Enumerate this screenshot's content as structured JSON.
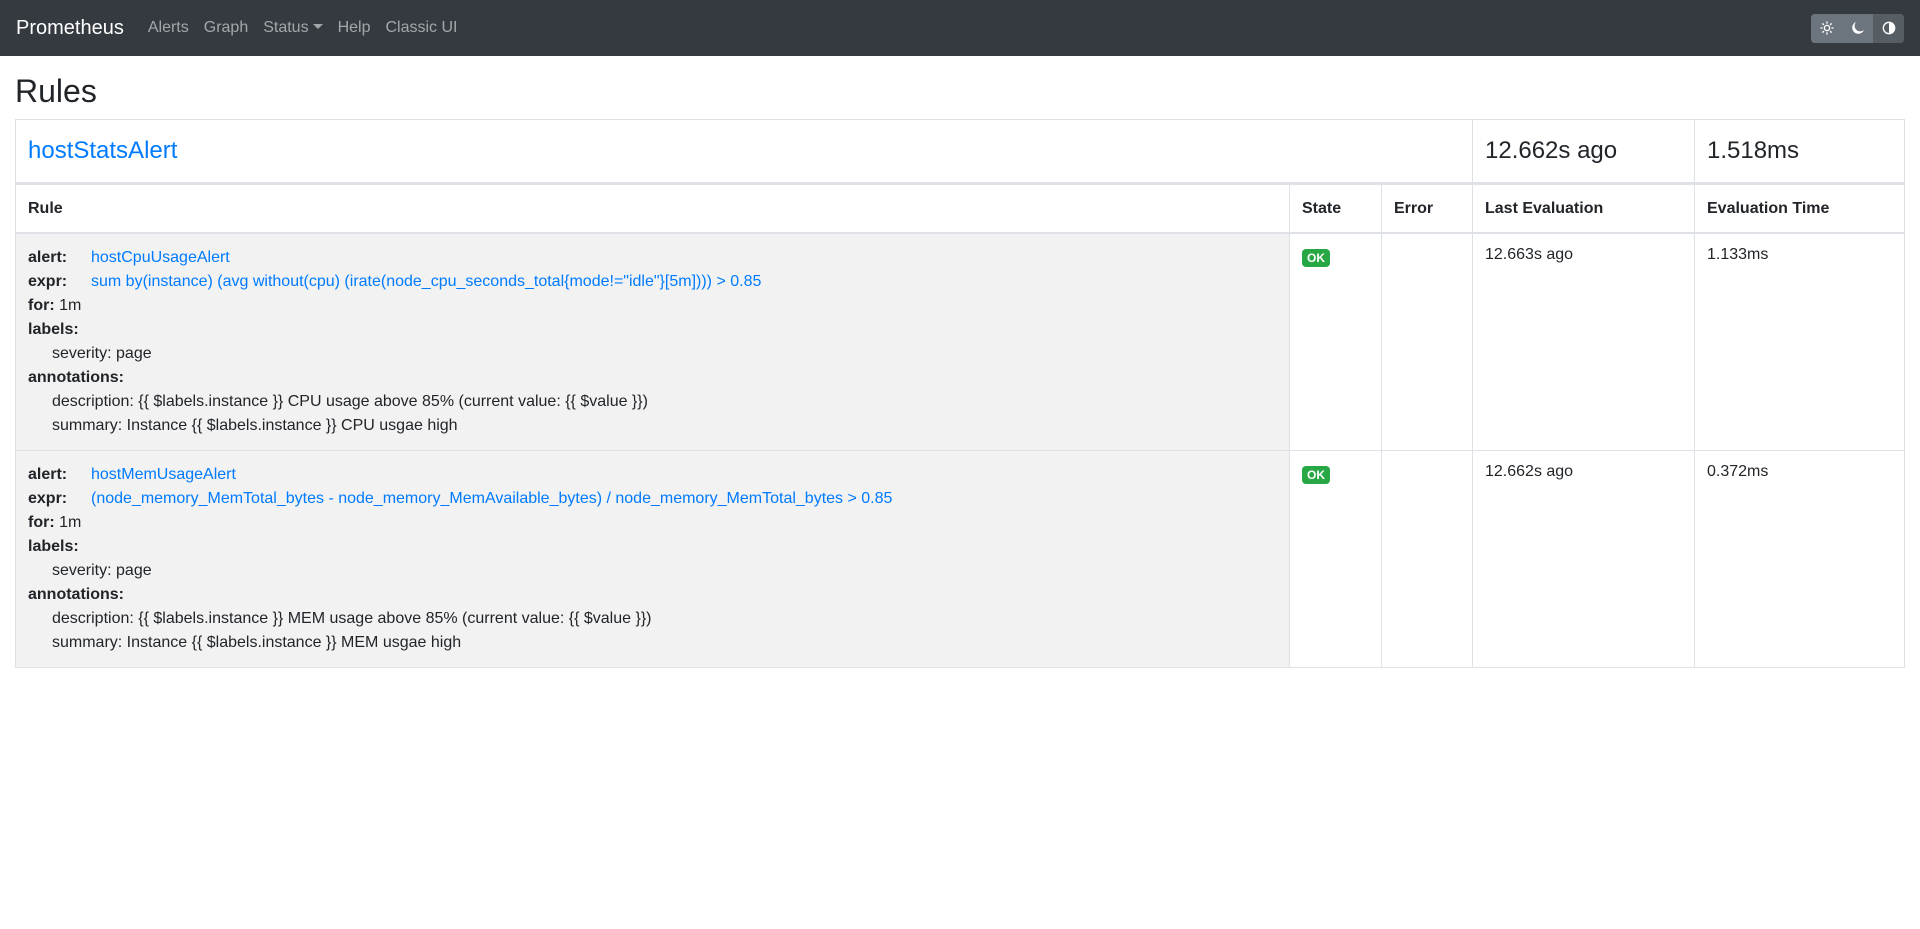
{
  "navbar": {
    "brand": "Prometheus",
    "links": [
      "Alerts",
      "Graph",
      "Status",
      "Help",
      "Classic UI"
    ]
  },
  "page": {
    "title": "Rules"
  },
  "group": {
    "name": "hostStatsAlert",
    "last_evaluation": "12.662s ago",
    "evaluation_time": "1.518ms"
  },
  "table": {
    "headers": [
      "Rule",
      "State",
      "Error",
      "Last Evaluation",
      "Evaluation Time"
    ]
  },
  "rules": [
    {
      "alert_key": "alert:",
      "alert": "hostCpuUsageAlert",
      "expr_key": "expr:",
      "expr": "sum by(instance) (avg without(cpu) (irate(node_cpu_seconds_total{mode!=\"idle\"}[5m]))) > 0.85",
      "for_key": "for:",
      "for": "1m",
      "labels_key": "labels:",
      "severity": "severity: page",
      "annotations_key": "annotations:",
      "description": "description: {{ $labels.instance }} CPU usage above 85% (current value: {{ $value }})",
      "summary": "summary: Instance {{ $labels.instance }} CPU usgae high",
      "state": "OK",
      "error": "",
      "last_evaluation": "12.663s ago",
      "evaluation_time": "1.133ms"
    },
    {
      "alert_key": "alert:",
      "alert": "hostMemUsageAlert",
      "expr_key": "expr:",
      "expr": "(node_memory_MemTotal_bytes - node_memory_MemAvailable_bytes) / node_memory_MemTotal_bytes > 0.85",
      "for_key": "for:",
      "for": "1m",
      "labels_key": "labels:",
      "severity": "severity: page",
      "annotations_key": "annotations:",
      "description": "description: {{ $labels.instance }} MEM usage above 85% (current value: {{ $value }})",
      "summary": "summary: Instance {{ $labels.instance }} MEM usgae high",
      "state": "OK",
      "error": "",
      "last_evaluation": "12.662s ago",
      "evaluation_time": "0.372ms"
    }
  ],
  "colors": {
    "navbar_bg": "#343a40",
    "link": "#007bff",
    "ok_badge": "#28a745",
    "row_bg": "#f2f2f2"
  },
  "icons": {
    "theme_light": "sun-icon",
    "theme_dark": "moon-icon",
    "theme_auto": "contrast-icon"
  }
}
